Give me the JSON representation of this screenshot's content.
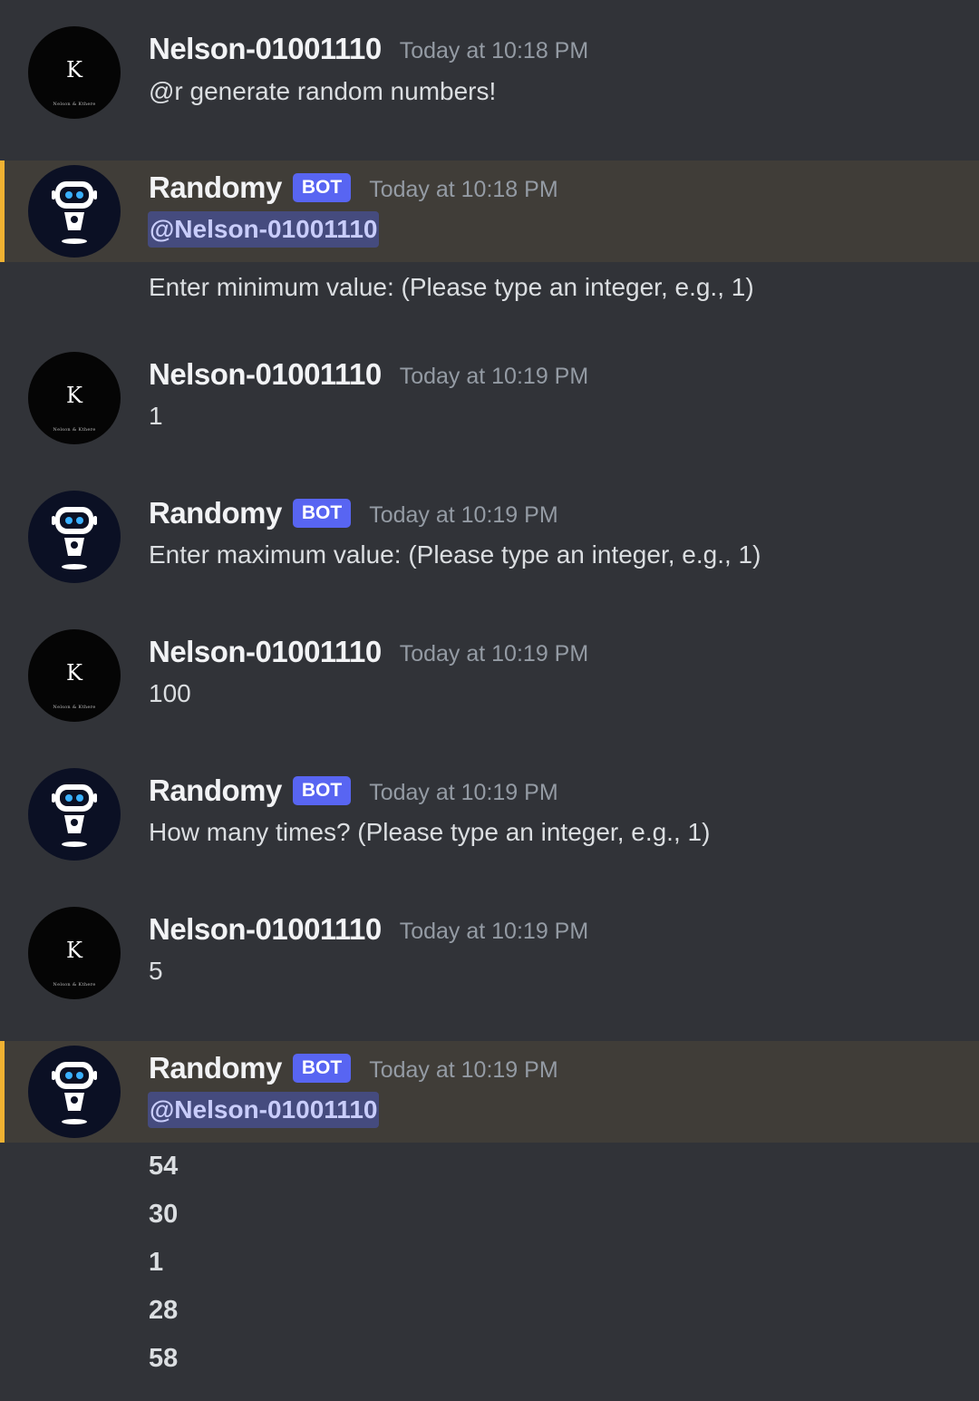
{
  "users": {
    "nelson": {
      "name": "Nelson-01001110",
      "avatar_letter": "K",
      "avatar_caption": "Nelson & Kthere"
    },
    "randomy": {
      "name": "Randomy",
      "tag": "BOT"
    }
  },
  "messages": [
    {
      "author": "Nelson-01001110",
      "timestamp": "Today at 10:18 PM",
      "text": "@r generate random numbers!"
    },
    {
      "author": "Randomy",
      "tag": "BOT",
      "timestamp": "Today at 10:18 PM",
      "mention": "@Nelson-01001110",
      "text": "Enter minimum value: (Please type an integer, e.g., 1)"
    },
    {
      "author": "Nelson-01001110",
      "timestamp": "Today at 10:19 PM",
      "text": "1"
    },
    {
      "author": "Randomy",
      "tag": "BOT",
      "timestamp": "Today at 10:19 PM",
      "text": "Enter maximum value: (Please type an integer, e.g., 1)"
    },
    {
      "author": "Nelson-01001110",
      "timestamp": "Today at 10:19 PM",
      "text": "100"
    },
    {
      "author": "Randomy",
      "tag": "BOT",
      "timestamp": "Today at 10:19 PM",
      "text": "How many times? (Please type an integer, e.g., 1)"
    },
    {
      "author": "Nelson-01001110",
      "timestamp": "Today at 10:19 PM",
      "text": "5"
    },
    {
      "author": "Randomy",
      "tag": "BOT",
      "timestamp": "Today at 10:19 PM",
      "mention": "@Nelson-01001110",
      "results": [
        "54",
        "30",
        "1",
        "28",
        "58"
      ]
    }
  ],
  "colors": {
    "background": "#313338",
    "mention_highlight": "#403d38",
    "mention_bar": "#f0b232",
    "bot_tag": "#5865f2",
    "mention_pill": "#454b7e"
  }
}
